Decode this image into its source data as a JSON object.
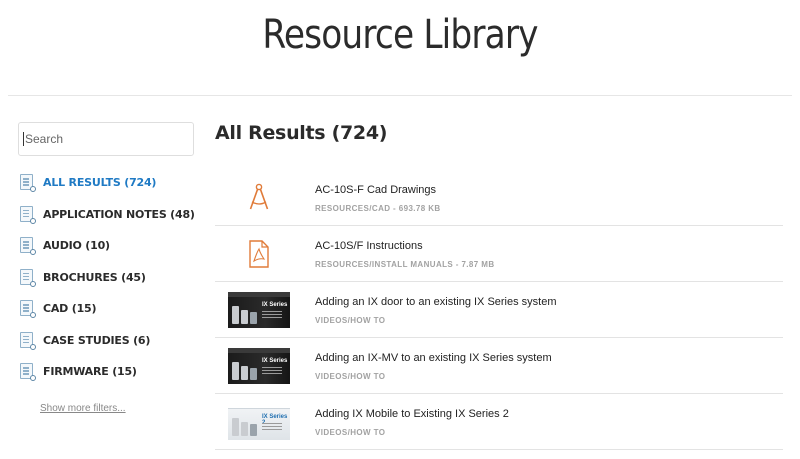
{
  "page": {
    "title": "Resource Library"
  },
  "search": {
    "placeholder": "Search",
    "value": ""
  },
  "sidebar": {
    "filters": [
      {
        "label": "ALL RESULTS (724)",
        "active": true
      },
      {
        "label": "APPLICATION NOTES (48)",
        "active": false
      },
      {
        "label": "AUDIO (10)",
        "active": false
      },
      {
        "label": "BROCHURES (45)",
        "active": false
      },
      {
        "label": "CAD (15)",
        "active": false
      },
      {
        "label": "CASE STUDIES (6)",
        "active": false
      },
      {
        "label": "FIRMWARE (15)",
        "active": false
      }
    ],
    "show_more": "Show more filters..."
  },
  "main": {
    "heading": "All Results (724)",
    "results": [
      {
        "title": "AC-10S-F Cad Drawings",
        "meta": "RESOURCES/CAD - 693.78 KB",
        "thumb": "compass-icon"
      },
      {
        "title": "AC-10S/F Instructions",
        "meta": "RESOURCES/INSTALL MANUALS - 7.87 MB",
        "thumb": "pdf-icon"
      },
      {
        "title": "Adding an IX door to an existing IX Series system",
        "meta": "VIDEOS/HOW TO",
        "thumb": "video-thumbnail",
        "thumb_text": "IX Series"
      },
      {
        "title": "Adding an IX-MV to an existing IX Series system",
        "meta": "VIDEOS/HOW TO",
        "thumb": "video-thumbnail",
        "thumb_text": "IX Series"
      },
      {
        "title": "Adding IX Mobile to Existing IX Series 2",
        "meta": "VIDEOS/HOW TO",
        "thumb": "video-thumbnail",
        "thumb_text": "IX Series 2"
      }
    ]
  },
  "colors": {
    "accent": "#1f7ac4",
    "icon_orange": "#e07b39",
    "meta_gray": "#a2a2a2"
  }
}
